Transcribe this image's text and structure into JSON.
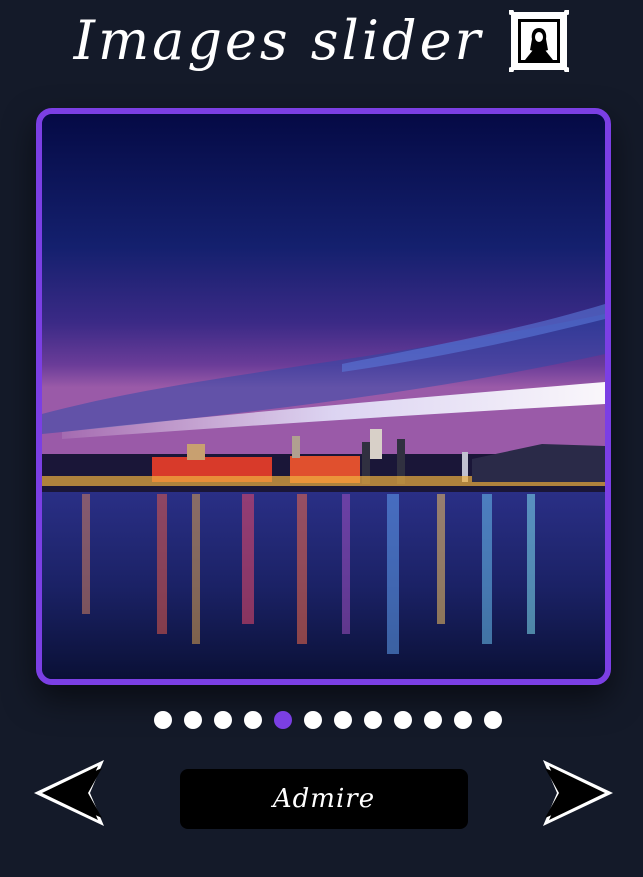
{
  "header": {
    "title": "Images slider",
    "icon": "framed-picture-icon"
  },
  "slider": {
    "image_subject": "night-harbor-cityscape",
    "slide_count": 12,
    "active_index": 4,
    "caption": "Admire",
    "prev_icon": "arrow-left-icon",
    "next_icon": "arrow-right-icon"
  },
  "colors": {
    "background": "#141a29",
    "accent": "#7b3fe4",
    "dot": "#ffffff",
    "caption_bg": "#000000"
  }
}
